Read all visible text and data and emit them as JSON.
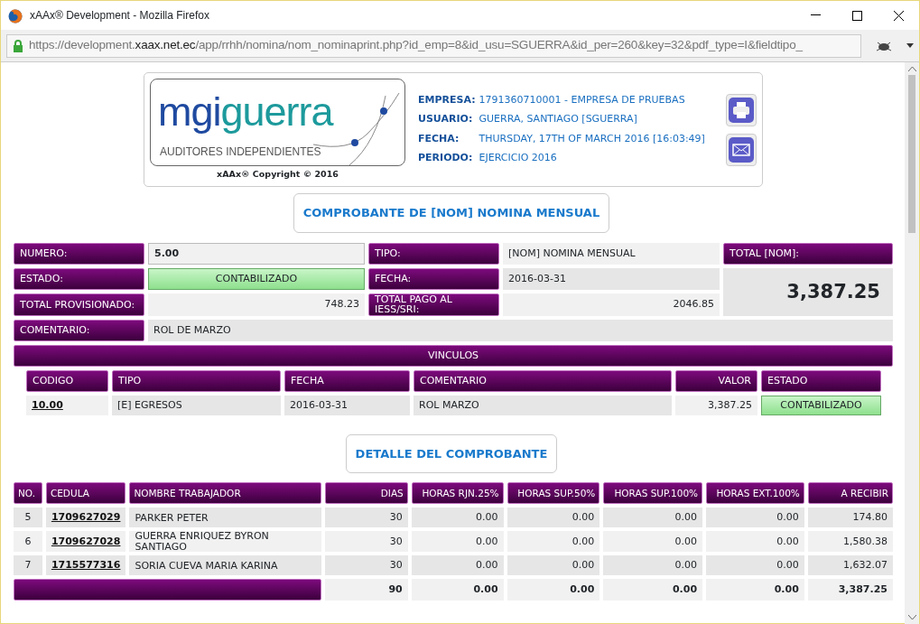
{
  "window": {
    "title": "xAAx® Development - Mozilla Firefox",
    "url_prefix": "https://development.",
    "url_domain": "xaax.net.ec",
    "url_rest": "/app/rrhh/nomina/nom_nominaprint.php?id_emp=8&id_usu=SGUERRA&id_per=260&key=32&pdf_type=I&fieldtipo_"
  },
  "header": {
    "logo": {
      "brand_first": "mgi",
      "brand_second": "guerra",
      "tagline": "AUDITORES INDEPENDIENTES"
    },
    "copyright": "xAAx® Copyright © 2016",
    "info": [
      {
        "label": "EMPRESA:",
        "value": "1791360710001 - EMPRESA DE PRUEBAS"
      },
      {
        "label": "USUARIO:",
        "value": "GUERRA, SANTIAGO [SGUERRA]"
      },
      {
        "label": "FECHA:",
        "value": "THURSDAY, 17TH OF MARCH 2016 [16:03:49]"
      },
      {
        "label": "PERIODO:",
        "value": "EJERCICIO 2016"
      }
    ]
  },
  "document_title": "COMPROBANTE DE [NOM] NOMINA MENSUAL",
  "form": {
    "numero": {
      "label": "NUMERO:",
      "value": "5.00"
    },
    "tipo": {
      "label": "TIPO:",
      "value": "[NOM] NOMINA MENSUAL"
    },
    "total": {
      "label": "TOTAL [NOM]:",
      "value": "3,387.25"
    },
    "estado": {
      "label": "ESTADO:",
      "value": "CONTABILIZADO"
    },
    "fecha": {
      "label": "FECHA:",
      "value": "2016-03-31"
    },
    "total_provisionado": {
      "label": "TOTAL PROVISIONADO:",
      "value": "748.23"
    },
    "total_pago": {
      "label": "TOTAL PAGO AL IESS/SRI:",
      "value": "2046.85"
    },
    "comentario": {
      "label": "COMENTARIO:",
      "value": "ROL DE MARZO"
    }
  },
  "vinculos": {
    "title": "VINCULOS",
    "columns": [
      "CODIGO",
      "TIPO",
      "FECHA",
      "COMENTARIO",
      "VALOR",
      "ESTADO"
    ],
    "rows": [
      [
        "10.00",
        "[E] EGRESOS",
        "2016-03-31",
        "ROL MARZO",
        "3,387.25",
        "CONTABILIZADO"
      ]
    ]
  },
  "detalle": {
    "title": "DETALLE DEL COMPROBANTE",
    "columns": [
      "NO.",
      "CEDULA",
      "NOMBRE TRABAJADOR",
      "DIAS",
      "HORAS RJN.25%",
      "HORAS SUP.50%",
      "HORAS SUP.100%",
      "HORAS EXT.100%",
      "A RECIBIR"
    ],
    "rows": [
      [
        "5",
        "1709627029",
        "PARKER PETER",
        "30",
        "0.00",
        "0.00",
        "0.00",
        "0.00",
        "174.80"
      ],
      [
        "6",
        "1709627028",
        "GUERRA ENRIQUEZ BYRON SANTIAGO",
        "30",
        "0.00",
        "0.00",
        "0.00",
        "0.00",
        "1,580.38"
      ],
      [
        "7",
        "1715577316",
        "SORIA CUEVA MARIA KARINA",
        "30",
        "0.00",
        "0.00",
        "0.00",
        "0.00",
        "1,632.07"
      ]
    ],
    "totals": [
      "90",
      "0.00",
      "0.00",
      "0.00",
      "0.00",
      "3,387.25"
    ]
  }
}
